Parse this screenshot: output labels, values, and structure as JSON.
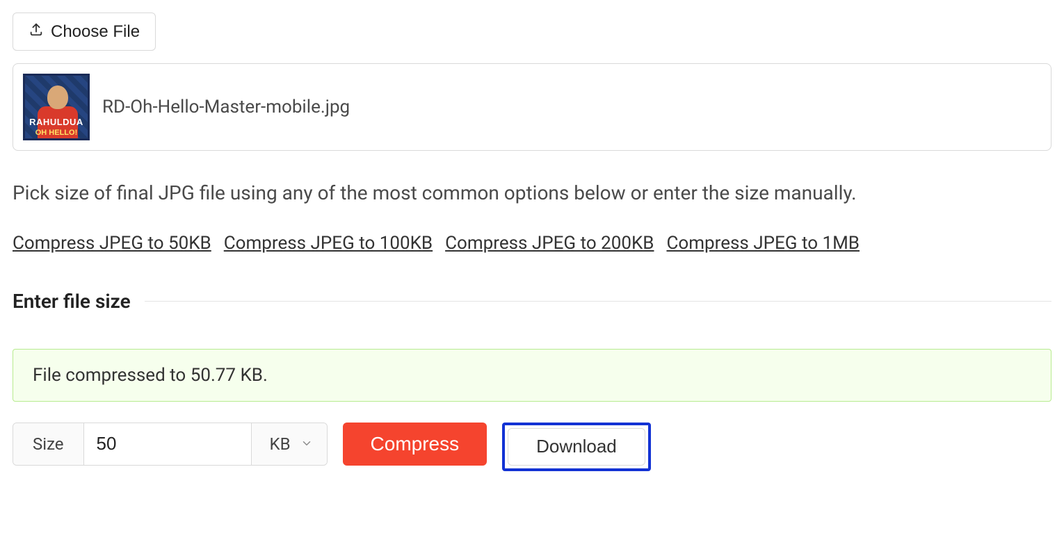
{
  "choose_file_label": "Choose File",
  "file": {
    "name": "RD-Oh-Hello-Master-mobile.jpg",
    "thumb_line1": "RAHULDUA",
    "thumb_line2": "OH HELLO!"
  },
  "description": "Pick size of final JPG file using any of the most common options below or enter the size manually.",
  "presets": [
    "Compress JPEG to 50KB",
    "Compress JPEG to 100KB",
    "Compress JPEG to 200KB",
    "Compress JPEG to 1MB"
  ],
  "section_title": "Enter file size",
  "status_message": "File compressed to 50.77 KB.",
  "size_label": "Size",
  "size_value": "50",
  "unit_label": "KB",
  "compress_label": "Compress",
  "download_label": "Download"
}
